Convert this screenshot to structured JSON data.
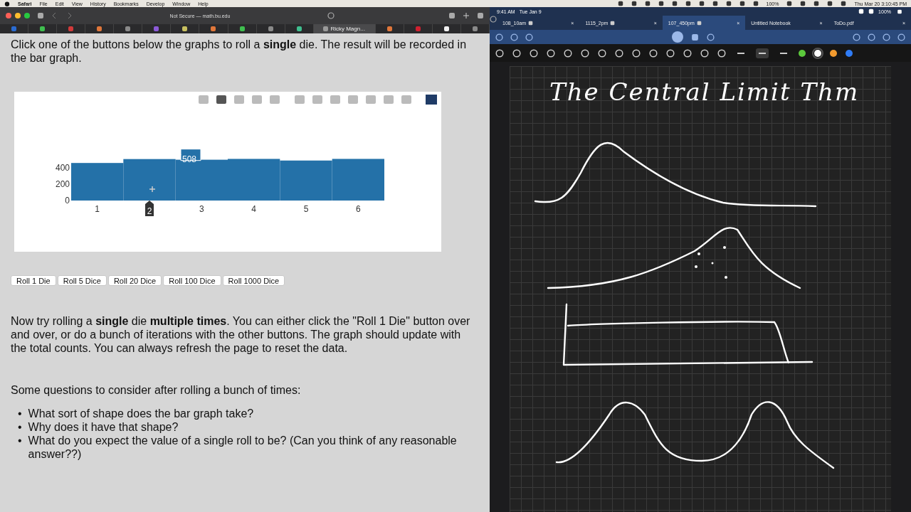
{
  "menubar": {
    "app": "Safari",
    "menus": [
      "File",
      "Edit",
      "View",
      "History",
      "Bookmarks",
      "Develop",
      "Window",
      "Help"
    ],
    "battery": "100%",
    "clock": "Thu Mar 20  3:10:45 PM"
  },
  "safari": {
    "address": "Not Secure — math.bu.edu",
    "tabs": [
      {
        "color": "#2a6bd1",
        "selected": false
      },
      {
        "color": "#3fbf4f",
        "selected": false
      },
      {
        "color": "#d23a3a",
        "selected": false
      },
      {
        "color": "#e0773a",
        "selected": false
      },
      {
        "color": "#8a8a8a",
        "selected": false
      },
      {
        "color": "#8c5ad8",
        "selected": false
      },
      {
        "color": "#c8c060",
        "selected": false
      },
      {
        "color": "#e0773a",
        "selected": false
      },
      {
        "color": "#3fbf4f",
        "selected": false
      },
      {
        "color": "#8a8a8a",
        "selected": false
      },
      {
        "color": "#3fbf8f",
        "selected": false
      },
      {
        "label": "Ricky Magn...",
        "color": "#9a9a9a",
        "selected": true
      },
      {
        "color": "#e0773a",
        "selected": false
      },
      {
        "color": "#d02030",
        "selected": false
      },
      {
        "color": "#f0f0f0",
        "selected": false
      },
      {
        "color": "#8a8a8a",
        "selected": false
      }
    ]
  },
  "page": {
    "intro": "Click one of the buttons below the graphs to roll a **single** die. The result will be recorded in the bar graph.",
    "chart": {
      "hover_value": "508",
      "hover_category": "2",
      "chart_data": {
        "type": "bar",
        "categories": [
          "1",
          "2",
          "3",
          "4",
          "5",
          "6"
        ],
        "values": [
          460,
          508,
          500,
          510,
          490,
          510
        ],
        "ylim": [
          0,
          540
        ],
        "yticks": [
          0,
          200,
          400
        ]
      }
    },
    "buttons": [
      "Roll 1 Die",
      "Roll 5 Dice",
      "Roll 20 Dice",
      "Roll 100 Dice",
      "Roll 1000 Dice"
    ],
    "instructions": "Now try rolling a **single** die **multiple times**. You can either click the \"Roll 1 Die\" button over and over, or do a bunch of iterations with the other buttons. The graph should update with the total counts. You can always refresh the page to reset the data.",
    "questions_intro": "Some questions to consider after rolling a bunch of times:",
    "questions": [
      {
        "bullet": "•",
        "text": "What sort of shape does the bar graph take?"
      },
      {
        "bullet": "•",
        "text": "Why does it have that shape?"
      },
      {
        "bullet": "•",
        "text": "What do you expect the value of a single roll to be? (Can you think of any reasonable answer??)"
      }
    ]
  },
  "ipad": {
    "time": "9:41 AM",
    "date": "Tue Jan 9",
    "battery": "100%",
    "tabs": [
      {
        "label": "108_10am",
        "shared": true,
        "selected": false,
        "close": "×"
      },
      {
        "label": "1115_2pm",
        "shared": true,
        "selected": false,
        "close": "×"
      },
      {
        "label": "107_450pm",
        "shared": true,
        "selected": true,
        "close": "×"
      },
      {
        "label": "Untitled Notebook",
        "shared": false,
        "selected": false,
        "close": "×"
      },
      {
        "label": "ToDo.pdf",
        "shared": false,
        "selected": false,
        "close": "×"
      }
    ],
    "strokes": [
      {
        "selected": false
      },
      {
        "selected": true
      },
      {
        "selected": false
      }
    ],
    "swatches": [
      {
        "color": "#5cc93c",
        "selected": false
      },
      {
        "color": "#ffffff",
        "selected": true
      },
      {
        "color": "#f29a2e",
        "selected": false
      },
      {
        "color": "#2f7cf6",
        "selected": false
      }
    ],
    "note_title": "The Central Limit Thm"
  }
}
